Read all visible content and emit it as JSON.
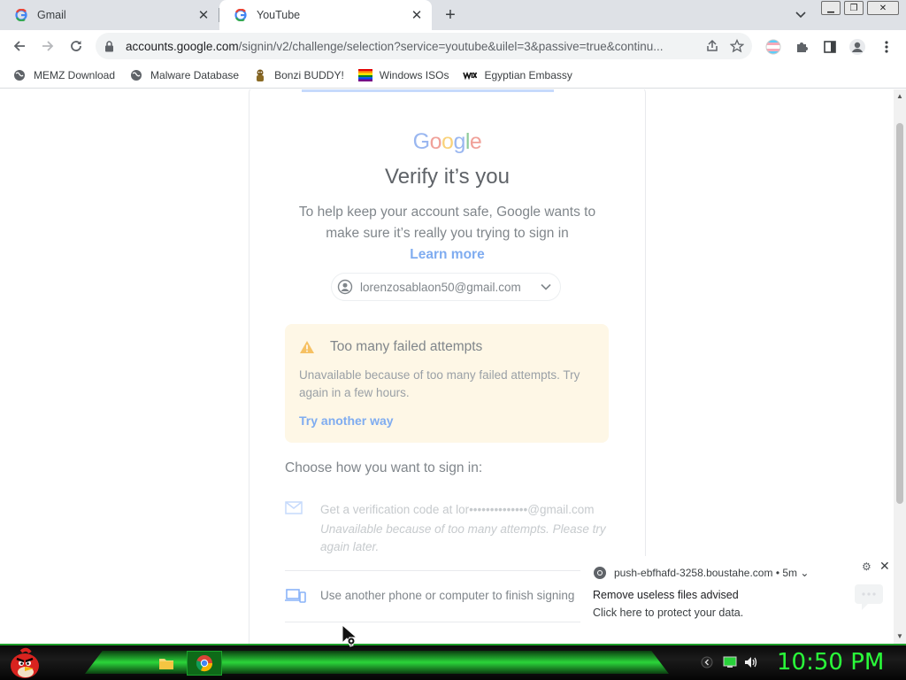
{
  "tabs": [
    {
      "title": "Gmail",
      "icon": "google-icon"
    },
    {
      "title": "YouTube",
      "icon": "google-icon"
    }
  ],
  "omnibox": {
    "url_host": "accounts.google.com",
    "url_rest": "/signin/v2/challenge/selection?service=youtube&uilel=3&passive=true&continu..."
  },
  "bookmarks": [
    {
      "label": "MEMZ Download",
      "icon": "globe-icon"
    },
    {
      "label": "Malware Database",
      "icon": "globe-icon"
    },
    {
      "label": "Bonzi BUDDY!",
      "icon": "bonzi-icon"
    },
    {
      "label": "Windows ISOs",
      "icon": "rainbow-flag-icon"
    },
    {
      "label": "Egyptian Embassy",
      "icon": "wix-icon"
    }
  ],
  "signin": {
    "logo": "Google",
    "title": "Verify it’s you",
    "subtitle": "To help keep your account safe, Google wants to make sure it’s really you trying to sign in",
    "learn_more": "Learn more",
    "account_email": "lorenzosablaon50@gmail.com",
    "alert_title": "Too many failed attempts",
    "alert_body": "Unavailable because of too many failed attempts. Try again in a few hours.",
    "alert_link": "Try another way",
    "choose_heading": "Choose how you want to sign in:",
    "option1_text": "Get a verification code at lor••••••••••••••@gmail.com",
    "option1_sub": "Unavailable because of too many attempts. Please try again later.",
    "option2_text": "Use another phone or computer to finish signing"
  },
  "notification": {
    "source": "push-ebfhafd-3258.boustahe.com",
    "age": "• 5m",
    "title": "Remove useless files advised",
    "body": "Click here to protect your data."
  },
  "taskbar": {
    "clock": "10:50 PM"
  },
  "colors": {
    "accent_blue": "#7facf0",
    "alert_bg": "#fef7e6",
    "warn_yellow": "#f9ab00",
    "taskbar_green": "#2bd53a",
    "clock_green": "#2aff3a"
  }
}
